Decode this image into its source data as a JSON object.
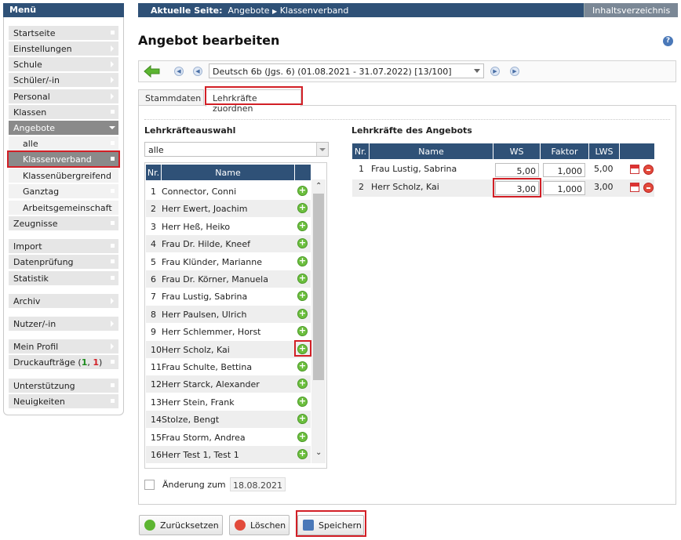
{
  "sidebar": {
    "title": "Menü",
    "items": [
      {
        "label": "Startseite"
      },
      {
        "label": "Einstellungen"
      },
      {
        "label": "Schule"
      },
      {
        "label": "Schüler/-in"
      },
      {
        "label": "Personal"
      },
      {
        "label": "Klassen"
      },
      {
        "label": "Angebote"
      }
    ],
    "subitems": [
      {
        "label": "alle"
      },
      {
        "label": "Klassenverband"
      },
      {
        "label": "Klassenübergreifend"
      },
      {
        "label": "Ganztag"
      },
      {
        "label": "Arbeitsgemeinschaft"
      }
    ],
    "items2": [
      {
        "label": "Zeugnisse"
      },
      {
        "label": "Import"
      },
      {
        "label": "Datenprüfung"
      },
      {
        "label": "Statistik"
      },
      {
        "label": "Archiv"
      },
      {
        "label": "Nutzer/-in"
      },
      {
        "label": "Mein Profil"
      }
    ],
    "print_jobs": {
      "label": "Druckaufträge (",
      "count1": "1",
      "sep": ", ",
      "count2": "1",
      "close": ")"
    },
    "items3": [
      {
        "label": "Unterstützung"
      },
      {
        "label": "Neuigkeiten"
      }
    ]
  },
  "header": {
    "current_label": "Aktuelle Seite:",
    "crumb1": "Angebote",
    "crumb2": "Klassenverband",
    "toc": "Inhaltsverzeichnis"
  },
  "page_title": "Angebot bearbeiten",
  "help_icon": "?",
  "nav": {
    "selected_offer": "Deutsch 6b (Jgs. 6) (01.08.2021 - 31.07.2022) [13/100]"
  },
  "tabs": [
    {
      "label": "Stammdaten"
    },
    {
      "label": "Lehrkräfte zuordnen"
    }
  ],
  "left_section": {
    "title": "Lehrkräfteauswahl",
    "filter": "alle",
    "col_nr": "Nr.",
    "col_name": "Name",
    "rows": [
      {
        "nr": "1",
        "name": "Connector, Conni"
      },
      {
        "nr": "2",
        "name": "Herr Ewert, Joachim"
      },
      {
        "nr": "3",
        "name": "Herr Heß, Heiko"
      },
      {
        "nr": "4",
        "name": "Frau Dr. Hilde, Kneef"
      },
      {
        "nr": "5",
        "name": "Frau Klünder, Marianne"
      },
      {
        "nr": "6",
        "name": "Frau Dr. Körner, Manuela"
      },
      {
        "nr": "7",
        "name": "Frau Lustig, Sabrina"
      },
      {
        "nr": "8",
        "name": "Herr Paulsen, Ulrich"
      },
      {
        "nr": "9",
        "name": "Herr Schlemmer, Horst"
      },
      {
        "nr": "10",
        "name": "Herr Scholz, Kai"
      },
      {
        "nr": "11",
        "name": "Frau Schulte, Bettina"
      },
      {
        "nr": "12",
        "name": "Herr Starck, Alexander"
      },
      {
        "nr": "13",
        "name": "Herr Stein, Frank"
      },
      {
        "nr": "14",
        "name": "Stolze, Bengt"
      },
      {
        "nr": "15",
        "name": "Frau Storm, Andrea"
      },
      {
        "nr": "16",
        "name": "Herr Test 1, Test 1"
      }
    ]
  },
  "right_section": {
    "title": "Lehrkräfte des Angebots",
    "cols": {
      "nr": "Nr.",
      "name": "Name",
      "ws": "WS",
      "faktor": "Faktor",
      "lws": "LWS"
    },
    "rows": [
      {
        "nr": "1",
        "name": "Frau Lustig, Sabrina",
        "ws": "5,00",
        "faktor": "1,000",
        "lws": "5,00"
      },
      {
        "nr": "2",
        "name": "Herr Scholz, Kai",
        "ws": "3,00",
        "faktor": "1,000",
        "lws": "3,00"
      }
    ]
  },
  "change": {
    "label": "Änderung zum",
    "date": "18.08.2021"
  },
  "buttons": {
    "reset": "Zurücksetzen",
    "delete": "Löschen",
    "save": "Speichern"
  },
  "colors": {
    "header_blue": "#2f5177",
    "highlight_red": "#d21f26",
    "add_green": "#6cbf3e",
    "remove_red": "#e24a3b"
  }
}
